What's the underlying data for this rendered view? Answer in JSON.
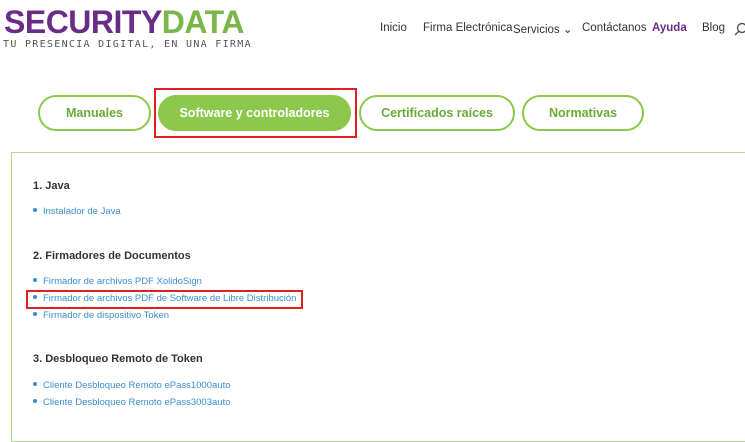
{
  "header": {
    "logo": {
      "security": "SECURITY",
      "data": "DATA",
      "tagline": "TU PRESENCIA DIGITAL, EN UNA FIRMA"
    },
    "nav": [
      "Inicio",
      "Firma Electrónica",
      "Servicios ⌄",
      "Contáctanos",
      "Ayuda",
      "Blog"
    ],
    "active_nav": "Ayuda"
  },
  "tabs": [
    "Manuales",
    "Software y controladores",
    "Certificados raíces",
    "Normativas"
  ],
  "active_tab": "Software y controladores",
  "sections": [
    {
      "title": "1. Java",
      "links": [
        "Instalador de Java"
      ]
    },
    {
      "title": "2. Firmadores de Documentos",
      "links": [
        "Firmador de archivos PDF XolidoSign",
        "Firmador de archivos PDF de Software de Libre Distribución",
        "Firmador de dispositivo Token"
      ]
    },
    {
      "title": "3. Desbloqueo Remoto de Token",
      "links": [
        "Cliente Desbloqueo Remoto ePass1000auto",
        "Cliente Desbloqueo Remoto ePass3003auto"
      ]
    }
  ],
  "colors": {
    "brand_purple": "#6a2d87",
    "brand_green": "#8cc84b",
    "link_blue": "#3a8fd0",
    "highlight_red": "#e02020"
  }
}
